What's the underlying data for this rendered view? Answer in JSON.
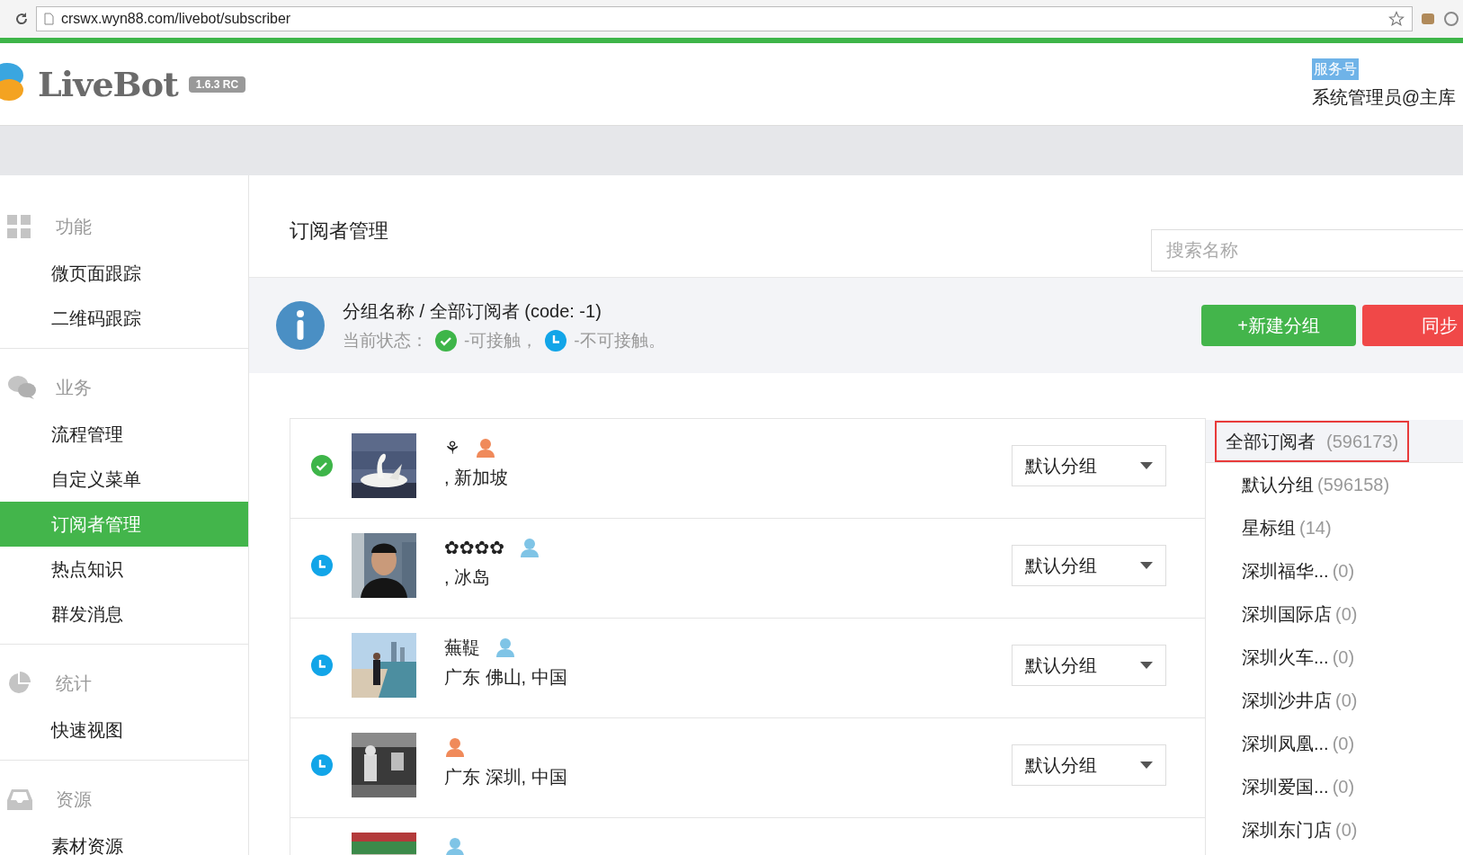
{
  "browser": {
    "url": "crswx.wyn88.com/livebot/subscriber"
  },
  "header": {
    "logo": "LiveBot",
    "version": "1.6.3 RC",
    "account_type": "服务号",
    "user": "系统管理员@主库"
  },
  "sidebar": {
    "sections": [
      {
        "title": "功能",
        "kind": "grid",
        "items": [
          {
            "label": "微页面跟踪",
            "selected": false
          },
          {
            "label": "二维码跟踪",
            "selected": false
          }
        ]
      },
      {
        "title": "业务",
        "kind": "chat",
        "items": [
          {
            "label": "流程管理",
            "selected": false
          },
          {
            "label": "自定义菜单",
            "selected": false
          },
          {
            "label": "订阅者管理",
            "selected": true
          },
          {
            "label": "热点知识",
            "selected": false
          },
          {
            "label": "群发消息",
            "selected": false
          }
        ]
      },
      {
        "title": "统计",
        "kind": "pie",
        "items": [
          {
            "label": "快速视图",
            "selected": false
          }
        ]
      },
      {
        "title": "资源",
        "kind": "inbox",
        "items": [
          {
            "label": "素材资源",
            "selected": false
          }
        ]
      }
    ]
  },
  "page": {
    "title": "订阅者管理",
    "search": {
      "placeholder": "搜索名称"
    }
  },
  "info": {
    "heading": "分组名称 / 全部订阅者 (code: -1)",
    "status_label": "当前状态：",
    "reachable_label": "-可接触，",
    "unreachable_label": "-不可接触。"
  },
  "buttons": [
    {
      "label": "+新建分组",
      "kind": "primary"
    },
    {
      "label": "同步",
      "kind": "danger"
    }
  ],
  "subscribers": [
    {
      "reachable": true,
      "name": "⚘",
      "female": true,
      "location": ", 新加坡",
      "group": "默认分组"
    },
    {
      "reachable": false,
      "name": "✿✿✿✿",
      "female": false,
      "location": ", 冰岛",
      "group": "默认分组"
    },
    {
      "reachable": false,
      "name": "蕪鞮",
      "female": false,
      "location": "广东 佛山, 中国",
      "group": "默认分组"
    },
    {
      "reachable": false,
      "female": true,
      "location": "广东 深圳, 中国",
      "group": "默认分组"
    },
    {
      "female": false
    }
  ],
  "groups": [
    {
      "name": "全部订阅者",
      "count": "(596173)",
      "selected": true
    },
    {
      "name": "默认分组",
      "count": "(596158)",
      "selected": false
    },
    {
      "name": "星标组",
      "count": "(14)",
      "selected": false
    },
    {
      "name": "深圳福华...",
      "count": "(0)",
      "selected": false
    },
    {
      "name": "深圳国际店",
      "count": "(0)",
      "selected": false
    },
    {
      "name": "深圳火车...",
      "count": "(0)",
      "selected": false
    },
    {
      "name": "深圳沙井店",
      "count": "(0)",
      "selected": false
    },
    {
      "name": "深圳凤凰...",
      "count": "(0)",
      "selected": false
    },
    {
      "name": "深圳爱国...",
      "count": "(0)",
      "selected": false
    },
    {
      "name": "深圳东门店",
      "count": "(0)",
      "selected": false
    }
  ]
}
